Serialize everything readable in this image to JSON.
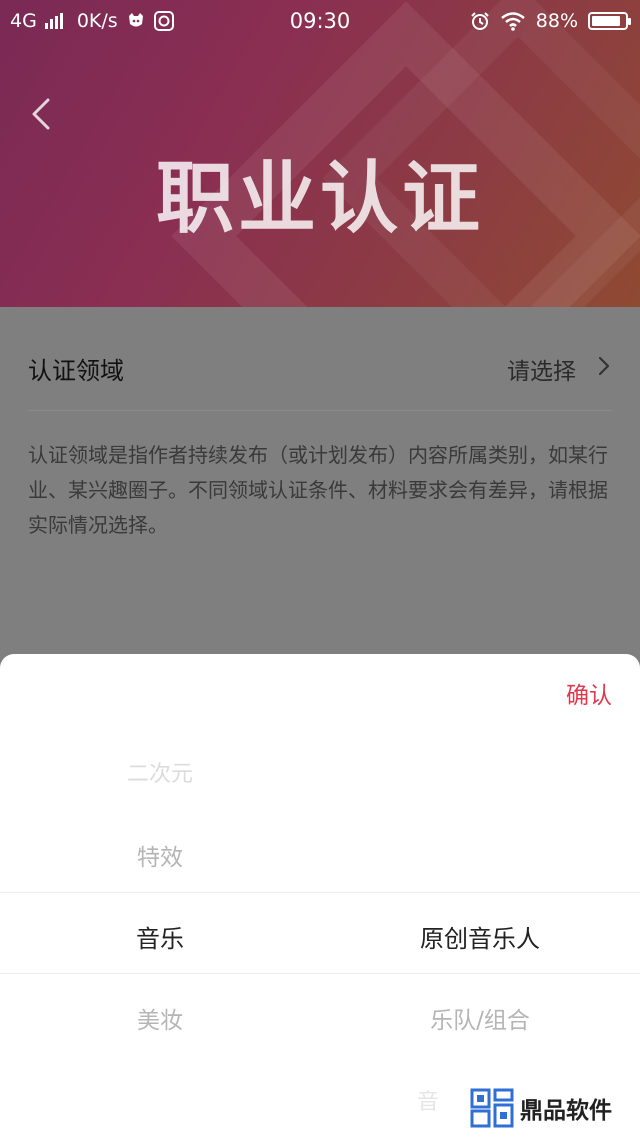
{
  "status_bar": {
    "network": "4G",
    "speed": "0K/s",
    "time": "09:30",
    "battery": "88%",
    "battery_level": 0.88
  },
  "header": {
    "title": "职业认证"
  },
  "field": {
    "label": "认证领域",
    "value": "请选择"
  },
  "description": "认证领域是指作者持续发布（或计划发布）内容所属类别，如某行业、某兴趣圈子。不同领域认证条件、材料要求会有差异，请根据实际情况选择。",
  "picker": {
    "confirm_label": "确认",
    "left_column": [
      "二次元",
      "特效",
      "音乐",
      "美妆"
    ],
    "right_column": [
      "原创音乐人",
      "乐队/组合",
      "音"
    ],
    "selected_left": "音乐",
    "selected_right": "原创音乐人"
  },
  "watermark": {
    "text": "鼎品软件"
  },
  "colors": {
    "accent": "#e0394d",
    "hero_start": "#7a2a55",
    "hero_end": "#8f4a32",
    "overlay": "#7f7f7f"
  }
}
